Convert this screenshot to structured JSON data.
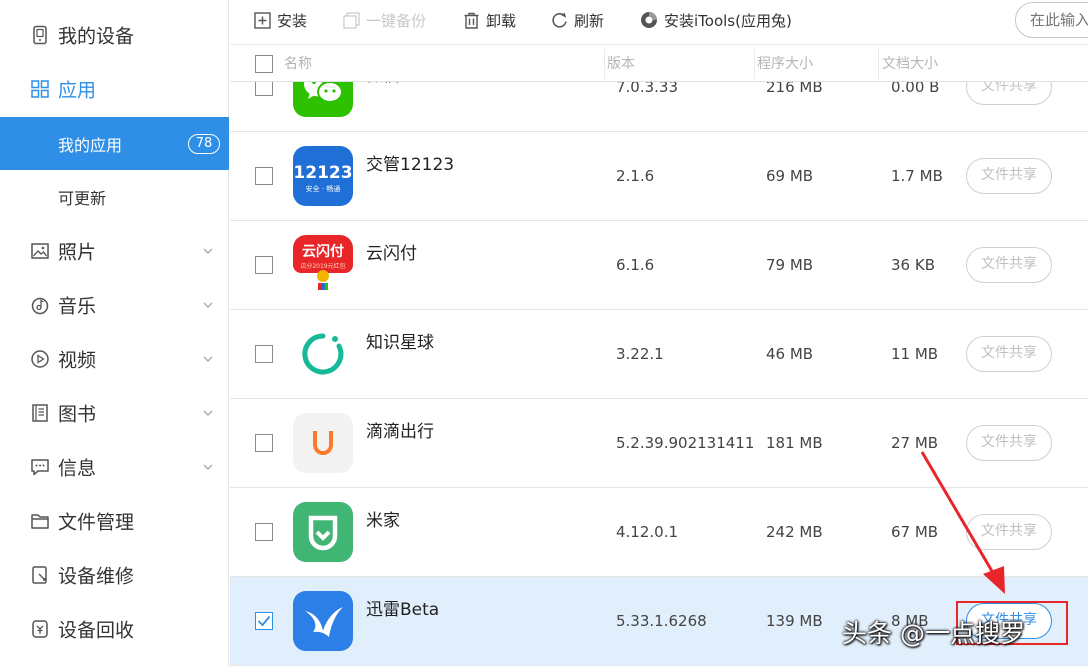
{
  "sidebar": {
    "my_device": "我的设备",
    "apps": "应用",
    "my_apps": "我的应用",
    "my_apps_count": "78",
    "updatable": "可更新",
    "photos": "照片",
    "music": "音乐",
    "video": "视频",
    "books": "图书",
    "messages": "信息",
    "file_manager": "文件管理",
    "device_repair": "设备维修",
    "device_recycle": "设备回收"
  },
  "toolbar": {
    "install": "安装",
    "backup": "一键备份",
    "uninstall": "卸载",
    "refresh": "刷新",
    "install_itools": "安装iTools(应用兔)",
    "search_placeholder": "在此输入"
  },
  "table": {
    "columns": {
      "name": "名称",
      "version": "版本",
      "app_size": "程序大小",
      "doc_size": "文档大小"
    },
    "share_label": "文件共享",
    "rows": [
      {
        "name": "微信",
        "version": "7.0.3.33",
        "app_size": "216 MB",
        "doc_size": "0.00 B",
        "icon": "wechat-icon",
        "checked": false
      },
      {
        "name": "交管12123",
        "version": "2.1.6",
        "app_size": "69 MB",
        "doc_size": "1.7 MB",
        "icon": "jiaoguan-icon",
        "icon_text": "12123",
        "icon_sub": "安全 · 畅通",
        "checked": false
      },
      {
        "name": "云闪付",
        "version": "6.1.6",
        "app_size": "79 MB",
        "doc_size": "36 KB",
        "icon": "yunshanfu-icon",
        "icon_text": "云闪付",
        "icon_sub": "瓜分2019元红包",
        "checked": false
      },
      {
        "name": "知识星球",
        "version": "3.22.1",
        "app_size": "46 MB",
        "doc_size": "11 MB",
        "icon": "zhishi-icon",
        "checked": false
      },
      {
        "name": "滴滴出行",
        "version": "5.2.39.902131411",
        "app_size": "181 MB",
        "doc_size": "27 MB",
        "icon": "didi-icon",
        "checked": false
      },
      {
        "name": "米家",
        "version": "4.12.0.1",
        "app_size": "242 MB",
        "doc_size": "67 MB",
        "icon": "mijia-icon",
        "checked": false
      },
      {
        "name": "迅雷Beta",
        "version": "5.33.1.6268",
        "app_size": "139 MB",
        "doc_size": "8 MB",
        "icon": "xunlei-icon",
        "checked": true
      }
    ]
  },
  "watermark": "头条 @一点搜罗",
  "colors": {
    "accent": "#2f8fe6",
    "selected_row": "#e1effc",
    "annotation_red": "#e8262a"
  }
}
